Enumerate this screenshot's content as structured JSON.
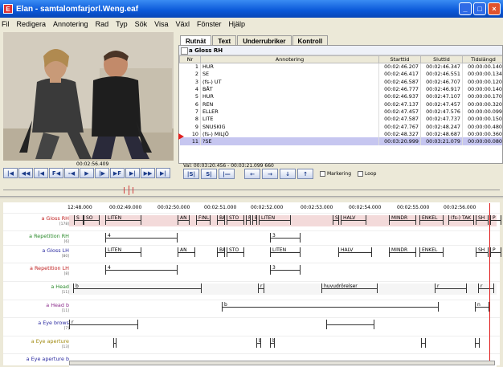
{
  "window": {
    "title": "Elan - samtalomfarjorl.Weng.eaf"
  },
  "menu": [
    "Fil",
    "Redigera",
    "Annotering",
    "Rad",
    "Typ",
    "Sök",
    "Visa",
    "Växl",
    "Fönster",
    "Hjälp"
  ],
  "video": {
    "time": "00:02:56.409"
  },
  "tabs": [
    "Rutnät",
    "Text",
    "Underrubriker",
    "Kontroll"
  ],
  "grid": {
    "tier": "a Gloss RH",
    "headers": [
      "Nr",
      "Annotering",
      "Starttid",
      "Sluttid",
      "Tidslängd"
    ],
    "rows": [
      {
        "nr": "1",
        "anno": "HUR",
        "start": "00:02:46.207",
        "end": "00:02:46.347",
        "dur": "00:00:00.140"
      },
      {
        "nr": "2",
        "anno": "SE",
        "start": "00:02:46.417",
        "end": "00:02:46.551",
        "dur": "00:00:00.134"
      },
      {
        "nr": "3",
        "anno": "(fs-) UT",
        "start": "00:02:46.587",
        "end": "00:02:46.707",
        "dur": "00:00:00.120"
      },
      {
        "nr": "4",
        "anno": "BÅT",
        "start": "00:02:46.777",
        "end": "00:02:46.917",
        "dur": "00:00:00.140"
      },
      {
        "nr": "5",
        "anno": "HUR",
        "start": "00:02:46.937",
        "end": "00:02:47.107",
        "dur": "00:00:00.170"
      },
      {
        "nr": "6",
        "anno": "REN",
        "start": "00:02:47.137",
        "end": "00:02:47.457",
        "dur": "00:00:00.320"
      },
      {
        "nr": "7",
        "anno": "ELLER",
        "start": "00:02:47.457",
        "end": "00:02:47.576",
        "dur": "00:00:00.099"
      },
      {
        "nr": "8",
        "anno": "LITE",
        "start": "00:02:47.587",
        "end": "00:02:47.737",
        "dur": "00:00:00.150"
      },
      {
        "nr": "9",
        "anno": "SNUSKIG",
        "start": "00:02:47.767",
        "end": "00:02:48.247",
        "dur": "00:00:00.480"
      },
      {
        "nr": "10",
        "anno": "(fs-) MILJÖ",
        "start": "00:02:48.327",
        "end": "00:02:48.687",
        "dur": "00:00:00.360"
      },
      {
        "nr": "11",
        "anno": "?SE",
        "start": "00:03:20.999",
        "end": "00:03:21.079",
        "dur": "00:00:00.080"
      }
    ],
    "selected_row": 10
  },
  "selection": {
    "text": "Val: 00:03:20.456 - 00:03:21.099 660"
  },
  "controls2": {
    "marking": "Markering",
    "loop": "Loop"
  },
  "ruler": [
    "12:48.000",
    "00:02:49.000",
    "00:02:50.000",
    "00:02:51.000",
    "00:02:52.000",
    "00:02:53.000",
    "00:02:54.000",
    "00:02:55.000",
    "00:02:56.000"
  ],
  "tiers": [
    {
      "name": "a Gloss RH",
      "count": "[178]",
      "color": "#c02020",
      "anns": [
        "S",
        "SO",
        "LITEN",
        "AN",
        "FINL",
        "BÅ",
        "STO",
        "P",
        "B",
        "LITEN",
        "S",
        "HALV",
        "MINDR",
        "ENKEL",
        "(fs-) TAK",
        "SH",
        "P"
      ]
    },
    {
      "name": "a Repetition RH",
      "count": "[6]",
      "color": "#2a8a2a",
      "anns": [
        "4",
        "3"
      ]
    },
    {
      "name": "a Gloss LH",
      "count": "[80]",
      "color": "#2a2aa0",
      "anns": [
        "LITEN",
        "AN",
        "BÅ",
        "STO",
        "LITEN",
        "HALV",
        "MINDR",
        "ENKEL",
        "SH",
        "P"
      ]
    },
    {
      "name": "a Repetition LH",
      "count": "[8]",
      "color": "#c02020",
      "anns": [
        "4",
        "3"
      ]
    },
    {
      "name": "a Head",
      "count": "[11]",
      "color": "#2a8a2a",
      "anns": [
        "b",
        "r",
        "huvudrörelser",
        "r",
        "r"
      ]
    },
    {
      "name": "a Head b",
      "count": "[11]",
      "color": "#8a2a8a",
      "anns": [
        "b",
        "n"
      ]
    },
    {
      "name": "a Eye brows",
      "count": "[7]",
      "color": "#2a2aa0",
      "anns": [
        "r"
      ]
    },
    {
      "name": "a Eye aperture",
      "count": "[13]",
      "color": "#a08a10",
      "anns": [
        "b",
        "b",
        "b"
      ]
    },
    {
      "name": "a Eye aperture b",
      "count": "",
      "color": "#2a2aa0",
      "anns": []
    }
  ],
  "icons": [
    "rewind-start-icon",
    "step-back-icon",
    "prev-frame-icon",
    "play-icon",
    "next-frame-icon",
    "forward-end-icon"
  ]
}
